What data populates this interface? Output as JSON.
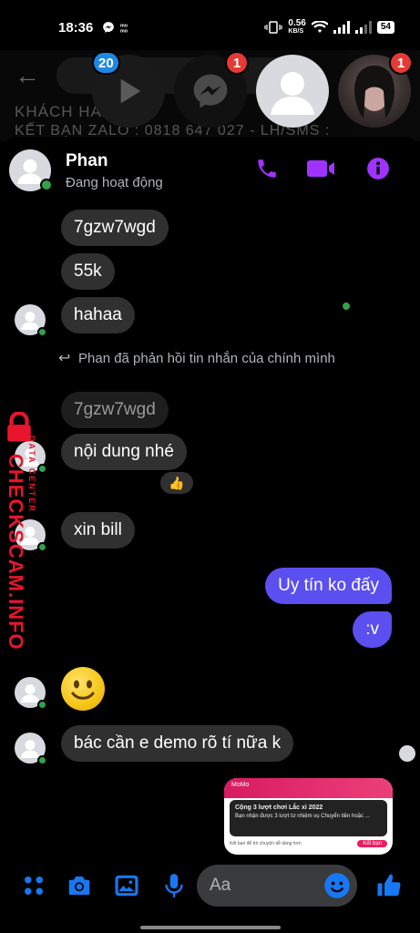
{
  "status_bar": {
    "time": "18:36",
    "left_icons": [
      "messenger-icon",
      "momo-icon"
    ],
    "network_speed": "0.56",
    "network_unit": "KB/S",
    "battery": "54"
  },
  "background_app": {
    "line1": "KHÁCH HÀ",
    "line2": "KẾT BẠN ZALO : 0818 647 027 - LH/SMS :"
  },
  "chat_heads": [
    {
      "name": "video",
      "badge": "20",
      "badge_color": "#1e88e5"
    },
    {
      "name": "messenger",
      "badge": "1",
      "badge_color": "#e53935"
    },
    {
      "name": "contact",
      "badge": ""
    },
    {
      "name": "girl",
      "badge": "1",
      "badge_color": "#e53935"
    }
  ],
  "header": {
    "name": "Phan",
    "status": "Đang hoạt động",
    "icons": [
      "phone-icon",
      "video-icon",
      "info-icon"
    ],
    "accent": "#a033ff"
  },
  "messages": {
    "m1": "7gzw7wgd",
    "m2": "55k",
    "m3": "hahaa",
    "reply_note": "Phan đã phản hồi tin nhắn của chính mình",
    "m4_quoted": "7gzw7wgd",
    "m5": "nội dung nhé",
    "reaction": "👍",
    "m6": "xin bill",
    "m7": "Uy tín ko đấy",
    "m8": ":v",
    "m9_emoji": "🙂",
    "m10": "bác cần e demo rõ tí nữa k"
  },
  "screenshot_preview": {
    "top": "MoMo",
    "title": "Cộng 3 lượt chơi Lắc xì 2022",
    "body": "Bạn nhận được 3 lượt từ nhiệm vụ Chuyển tiền hoặc ...",
    "bottom_left": "Kết bạn để trò chuyện dễ dàng hơn",
    "button": "Kết bạn"
  },
  "watermark": {
    "main": "CHECKSCAM.INFO",
    "sub": "DATA CENTER"
  },
  "composer": {
    "placeholder": "Aa",
    "icons": [
      "menu-dots-icon",
      "camera-icon",
      "image-icon",
      "mic-icon",
      "emoji-icon",
      "like-icon"
    ],
    "accent": "#1877f2"
  }
}
